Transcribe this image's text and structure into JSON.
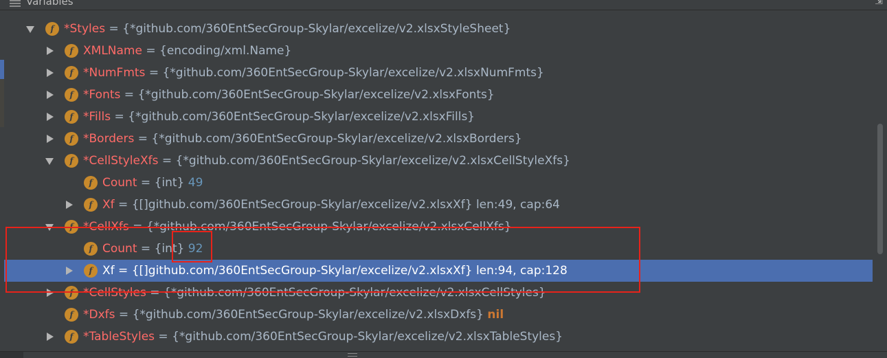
{
  "panel": {
    "title": "Variables"
  },
  "rows": [
    {
      "name": "*Styles",
      "type": "{*github.com/360EntSecGroup-Skylar/excelize/v2.xlsxStyleSheet}"
    },
    {
      "name": "XMLName",
      "type": "{encoding/xml.Name}"
    },
    {
      "name": "*NumFmts",
      "type": "{*github.com/360EntSecGroup-Skylar/excelize/v2.xlsxNumFmts}"
    },
    {
      "name": "*Fonts",
      "type": "{*github.com/360EntSecGroup-Skylar/excelize/v2.xlsxFonts}"
    },
    {
      "name": "*Fills",
      "type": "{*github.com/360EntSecGroup-Skylar/excelize/v2.xlsxFills}"
    },
    {
      "name": "*Borders",
      "type": "{*github.com/360EntSecGroup-Skylar/excelize/v2.xlsxBorders}"
    },
    {
      "name": "*CellStyleXfs",
      "type": "{*github.com/360EntSecGroup-Skylar/excelize/v2.xlsxCellStyleXfs}"
    },
    {
      "name": "Count",
      "type": "{int}",
      "value": "49"
    },
    {
      "name": "Xf",
      "type": "{[]github.com/360EntSecGroup-Skylar/excelize/v2.xlsxXf}",
      "meta": "len:49, cap:64"
    },
    {
      "name": "*CellXfs",
      "type": "{*github.com/360EntSecGroup-Skylar/excelize/v2.xlsxCellXfs}"
    },
    {
      "name": "Count",
      "type": "{int}",
      "value": "92"
    },
    {
      "name": "Xf",
      "type": "{[]github.com/360EntSecGroup-Skylar/excelize/v2.xlsxXf}",
      "meta": "len:94, cap:128"
    },
    {
      "name": "*CellStyles",
      "type": "{*github.com/360EntSecGroup-Skylar/excelize/v2.xlsxCellStyles}"
    },
    {
      "name": "*Dxfs",
      "type": "{*github.com/360EntSecGroup-Skylar/excelize/v2.xlsxDxfs}",
      "nil": "nil"
    },
    {
      "name": "*TableStyles",
      "type": "{*github.com/360EntSecGroup-Skylar/excelize/v2.xlsxTableStyles}"
    }
  ],
  "field_icon_letter": "f",
  "colors": {
    "background": "#3c3f41",
    "selection": "#4b6eaf",
    "field_name": "#ff6b68",
    "number_value": "#6897bb",
    "nil_keyword": "#cc7832",
    "field_icon": "#c88a2c",
    "annotation_box": "#e8231a"
  }
}
